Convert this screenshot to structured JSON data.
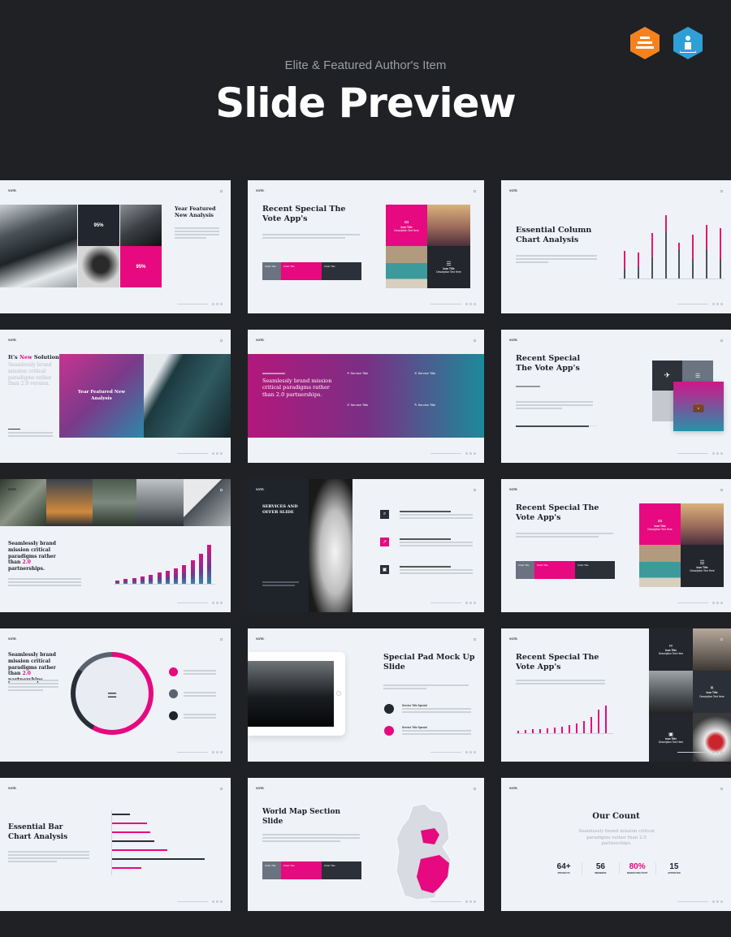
{
  "header": {
    "subtitle": "Elite & Featured Author's Item",
    "title": "Slide Preview",
    "badges": [
      {
        "icon": "stack-icon",
        "color": "#f5821f"
      },
      {
        "icon": "author-icon",
        "color": "#2f9fd6"
      }
    ]
  },
  "brand": "VOTE.",
  "colors": {
    "accent": "#e6097f",
    "dark": "#22262e",
    "page_background": "#1f2125",
    "slide_background": "#eff2f7"
  },
  "slides": {
    "s1": {
      "title": "Year Featured New Analysis",
      "stat1": "95%",
      "stat2": "95%"
    },
    "s2": {
      "title": "Recent Special The Vote App's",
      "icon_title": "Icon Title",
      "icon_desc": "Description Text Here",
      "bar_labels": [
        "Chart Title",
        "Chart Title",
        "Chart Title"
      ]
    },
    "s3": {
      "title": "Essential Column Chart Analysis",
      "columns": {
        "total": [
          0.42,
          0.4,
          0.7,
          0.98,
          0.55,
          0.68,
          0.82,
          0.77
        ],
        "base": [
          0.15,
          0.18,
          0.32,
          0.72,
          0.45,
          0.3,
          0.45,
          0.3
        ]
      }
    },
    "s4": {
      "title_pre": "It's ",
      "title_accent": "New",
      "title_post": " Solutions",
      "text": "Seamlessly brand mission critical paradigms rather than 2.0 version.",
      "overlay": "Year Featured New Analysis"
    },
    "s5": {
      "text": "Seamlessly brand mission critical paradigms rather than 2.0 partnerships.",
      "services": [
        "Service Title",
        "Service Title",
        "Service Title",
        "Service Title"
      ]
    },
    "s6": {
      "title": "Recent Special The Vote App's",
      "progress": 0.9
    },
    "s7": {
      "pre": "Seamlessly brand mission critical paradigms rather than ",
      "accent": "2.0",
      "post": " partnerships.",
      "bars": [
        0.08,
        0.12,
        0.14,
        0.18,
        0.22,
        0.26,
        0.3,
        0.36,
        0.44,
        0.56,
        0.72,
        0.92
      ]
    },
    "s8": {
      "title": "SERVICES AND OFFER SLIDE"
    },
    "s9": {
      "title": "Recent Special The Vote App's"
    },
    "s10": {
      "pre": "Seamlessly brand mission critical paradigms rather than ",
      "accent": "2.0",
      "post": " partnerships.",
      "ring": [
        0.58,
        0.27,
        0.15
      ]
    },
    "s11": {
      "title": "Special Pad Mock Up Slide",
      "items": [
        "Service Title Special",
        "Service Title Special"
      ]
    },
    "s12": {
      "title": "Recent Special The Vote App's",
      "icon_title": "Icon Title",
      "icon_desc": "Description Text Here",
      "bars": [
        0.1,
        0.12,
        0.15,
        0.14,
        0.18,
        0.2,
        0.25,
        0.3,
        0.35,
        0.45,
        0.6,
        0.85,
        1.0
      ]
    },
    "s13": {
      "title": "Essential Bar Chart Analysis",
      "bars": [
        {
          "v": 0.17,
          "c": "dark"
        },
        {
          "v": 0.33,
          "c": "pink"
        },
        {
          "v": 0.36,
          "c": "pink"
        },
        {
          "v": 0.4,
          "c": "dark"
        },
        {
          "v": 0.52,
          "c": "pink"
        },
        {
          "v": 0.88,
          "c": "dark"
        },
        {
          "v": 0.28,
          "c": "pink"
        }
      ]
    },
    "s14": {
      "title": "World Map Section Slide"
    },
    "s15": {
      "title": "Our Count",
      "subtitle": "Seamlessly brand mission critical paradigms rather than 2.0 partnerships.",
      "stats": [
        {
          "value": "64+",
          "label": "PROJECTS"
        },
        {
          "value": "56",
          "label": "MEMBERS"
        },
        {
          "value": "80%",
          "label": "MARKETING POST",
          "accent": true
        },
        {
          "value": "15",
          "label": "APPROVED"
        }
      ]
    }
  }
}
